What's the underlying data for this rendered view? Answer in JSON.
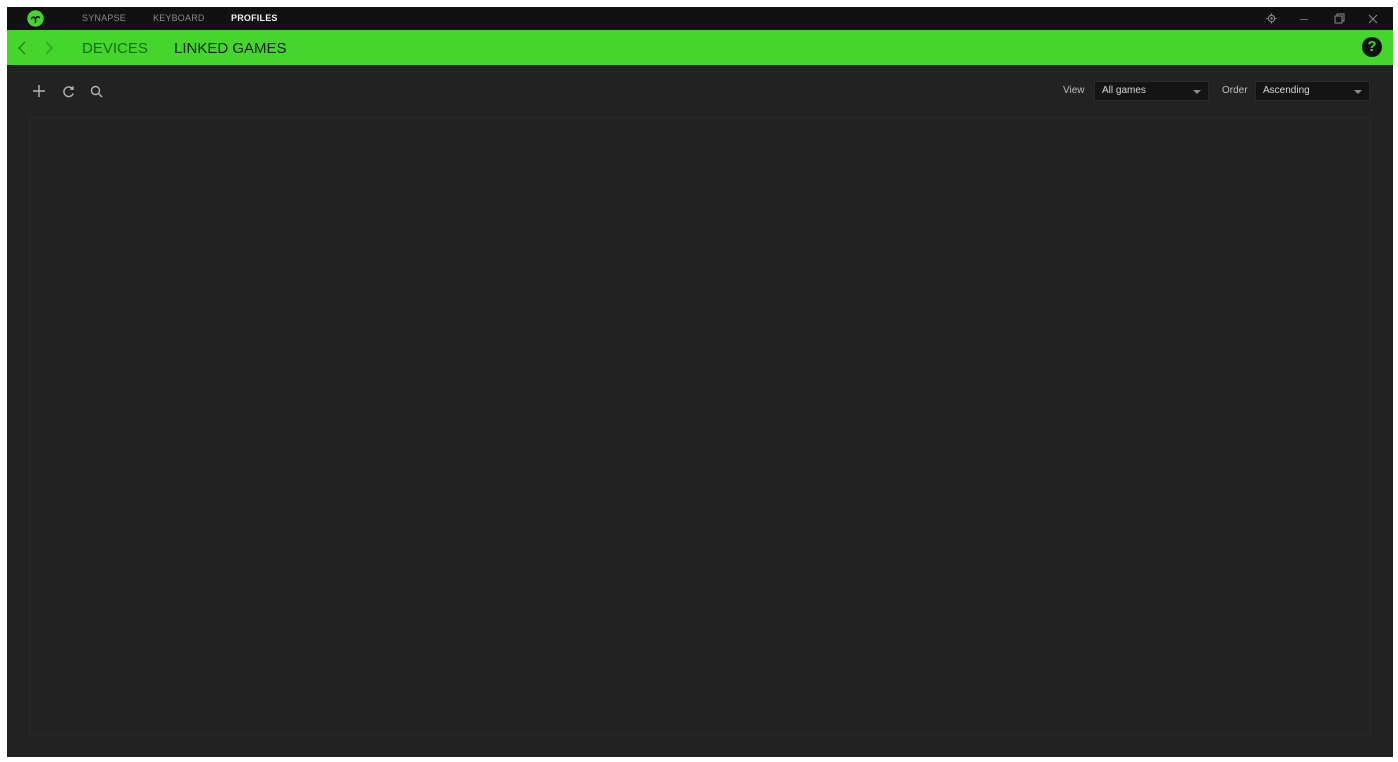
{
  "titlebar": {
    "tabs": [
      {
        "label": "SYNAPSE",
        "active": false
      },
      {
        "label": "KEYBOARD",
        "active": false
      },
      {
        "label": "PROFILES",
        "active": true
      }
    ],
    "icons": [
      "razer-logo-icon",
      "settings-icon",
      "minimize-icon",
      "restore-icon",
      "close-icon"
    ]
  },
  "subnav": {
    "tabs": [
      {
        "label": "DEVICES",
        "active": false
      },
      {
        "label": "LINKED GAMES",
        "active": true
      }
    ],
    "help_label": "?"
  },
  "toolbar": {
    "icons": [
      "add-icon",
      "refresh-icon",
      "search-icon"
    ],
    "view": {
      "label": "View",
      "value": "All games"
    },
    "order": {
      "label": "Order",
      "value": "Ascending"
    }
  },
  "colors": {
    "accent_green": "#44d62c",
    "titlebar_bg": "#111111",
    "app_bg": "#222222"
  }
}
